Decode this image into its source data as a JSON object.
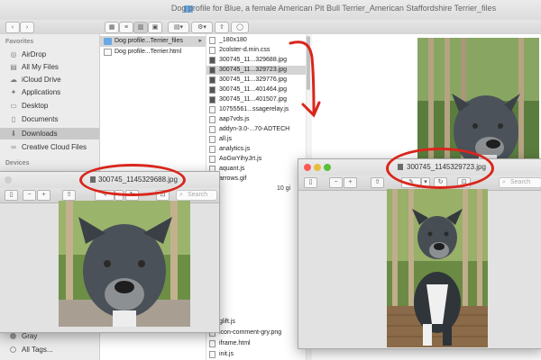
{
  "finder": {
    "title": "Dog profile for Blue, a female American Pit Bull Terrier_American Staffordshire Terrier_files",
    "sidebar": {
      "favorites_header": "Favorites",
      "devices_header": "Devices",
      "items": [
        {
          "label": "AirDrop",
          "icon": "airdrop-icon",
          "glyph": "◎"
        },
        {
          "label": "All My Files",
          "icon": "all-files-icon",
          "glyph": "▤"
        },
        {
          "label": "iCloud Drive",
          "icon": "cloud-icon",
          "glyph": "☁"
        },
        {
          "label": "Applications",
          "icon": "applications-icon",
          "glyph": "✦"
        },
        {
          "label": "Desktop",
          "icon": "desktop-icon",
          "glyph": "▭"
        },
        {
          "label": "Documents",
          "icon": "documents-icon",
          "glyph": "▯"
        },
        {
          "label": "Downloads",
          "icon": "downloads-icon",
          "glyph": "⬇"
        },
        {
          "label": "Creative Cloud Files",
          "icon": "creative-cloud-icon",
          "glyph": "∞"
        }
      ],
      "tags": [
        {
          "label": "Gray"
        },
        {
          "label": "All Tags..."
        }
      ]
    },
    "column1": [
      {
        "label": "Dog profile...Terrier_files",
        "selected": true
      },
      {
        "label": "Dog profile...Terrier.html",
        "selected": false
      }
    ],
    "column2": [
      {
        "label": "_180x180"
      },
      {
        "label": "2colster-d.min.css"
      },
      {
        "label": "300745_11...329688.jpg"
      },
      {
        "label": "300745_11...329723.jpg",
        "selected": true
      },
      {
        "label": "300745_11...329776.jpg"
      },
      {
        "label": "300745_11...401464.jpg"
      },
      {
        "label": "300745_11...401507.jpg"
      },
      {
        "label": "10755561...ssagerelay.js"
      },
      {
        "label": "aap7vds.js"
      },
      {
        "label": "addyn-3.0-...70-ADTECH"
      },
      {
        "label": "all.js"
      },
      {
        "label": "analytics.js"
      },
      {
        "label": "AoGwYihyJrt.js"
      },
      {
        "label": "aquant.js"
      },
      {
        "label": "arrows.gif"
      },
      {
        "label": "glift.js"
      },
      {
        "label": "icon-comment-gry.png"
      },
      {
        "label": "iframe.html"
      },
      {
        "label": "init.js"
      }
    ],
    "size_fragment": "10 gi"
  },
  "preview_left": {
    "filename": "300745_1145329688.jpg",
    "search_placeholder": "Search"
  },
  "preview_right": {
    "filename": "300745_1145329723.jpg",
    "search_placeholder": "Search"
  },
  "colors": {
    "annotation_red": "#d9261c",
    "sidebar_bg": "#ececec",
    "folder_blue": "#6aa9e3"
  }
}
